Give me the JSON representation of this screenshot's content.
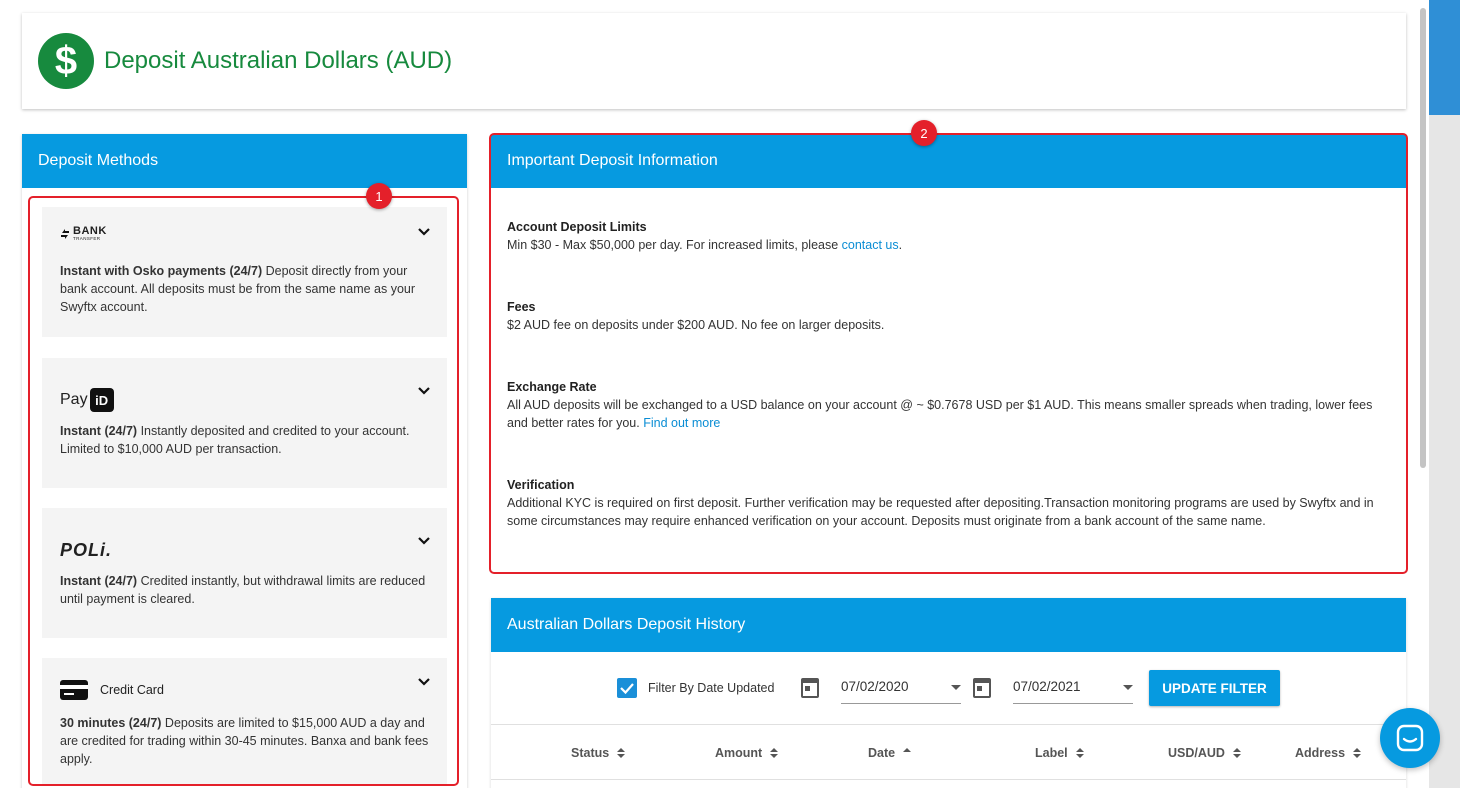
{
  "header": {
    "title": "Deposit Australian Dollars (AUD)",
    "icon_glyph": "$"
  },
  "methods": {
    "heading": "Deposit Methods",
    "items": [
      {
        "logo_big": "BANK",
        "logo_small": "TRANSFER",
        "bold": "Instant with Osko payments (24/7)",
        "text": " Deposit directly from your bank account. All deposits must be from the same name as your Swyftx account."
      },
      {
        "logo_text": "Pay",
        "logo_box": "iD",
        "bold": "Instant (24/7)",
        "text": " Instantly deposited and credited to your account. Limited to $10,000 AUD per transaction."
      },
      {
        "logo_text": "POLi.",
        "bold": "Instant (24/7)",
        "text": " Credited instantly, but withdrawal limits are reduced until payment is cleared."
      },
      {
        "label": "Credit Card",
        "bold": "30 minutes (24/7)",
        "text": " Deposits are limited to $15,000 AUD a day and are credited for trading within 30-45 minutes. Banxa and bank fees apply."
      }
    ]
  },
  "info": {
    "heading": "Important Deposit Information",
    "limits_title": "Account Deposit Limits",
    "limits_text": "Min $30 - Max $50,000 per day. For increased limits, please ",
    "limits_link": "contact us",
    "limits_end": ".",
    "fees_title": "Fees",
    "fees_text": "$2 AUD fee on deposits under $200 AUD. No fee on larger deposits.",
    "rate_title": "Exchange Rate",
    "rate_text": "All AUD deposits will be exchanged to a USD balance on your account @ ~ $0.7678 USD per $1 AUD. This means smaller spreads when trading, lower fees and better rates for you. ",
    "rate_link": "Find out more",
    "verify_title": "Verification",
    "verify_text": "Additional KYC is required on first deposit. Further verification may be requested after depositing.Transaction monitoring programs are used by Swyftx and in some circumstances may require enhanced verification on your account. Deposits must originate from a bank account of the same name."
  },
  "history": {
    "heading": "Australian Dollars Deposit History",
    "filter_label": "Filter By Date Updated",
    "filter_checked": true,
    "date_from": "07/02/2020",
    "date_to": "07/02/2021",
    "update_button": "UPDATE FILTER",
    "columns": [
      "Status",
      "Amount",
      "Date",
      "Label",
      "USD/AUD",
      "Address"
    ]
  },
  "annotations": {
    "badge_1": "1",
    "badge_2": "2"
  },
  "colors": {
    "brand_green": "#178a3e",
    "header_blue": "#069ae0",
    "annotation_red": "#e4202a",
    "link_blue": "#0a8dd4"
  }
}
